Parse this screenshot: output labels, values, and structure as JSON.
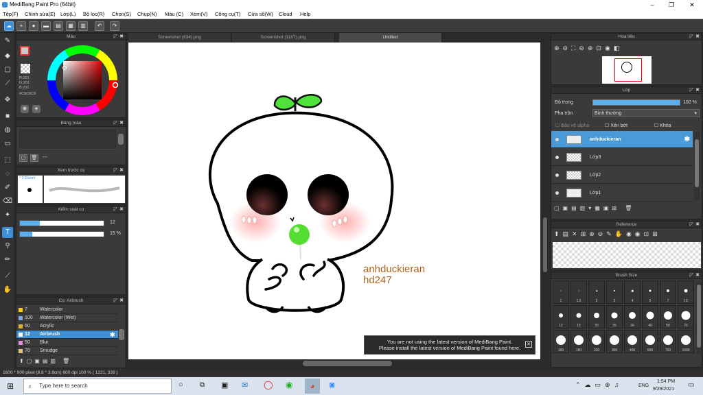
{
  "window": {
    "title": "MediBang Paint Pro (64bit)",
    "min": "–",
    "max": "❐",
    "close": "✕"
  },
  "menu": [
    "Tệp(F)",
    "Chỉnh sửa(E)",
    "Lớp(L)",
    "Bộ lọc(R)",
    "Chọn(S)",
    "Chụp(N)",
    "Màu (C)",
    "Xem(V)",
    "Công cụ(T)",
    "Cửa sổ(W)",
    "Cloud",
    "Help"
  ],
  "tabs": [
    "Screenshot (634).png",
    "Screenshot (1187).png",
    "Untitled"
  ],
  "color_panel": {
    "title": "Màu",
    "r": "R:201",
    "g": "G:201",
    "b": "B:201",
    "hex": "#C9C9C9",
    "current": "#c9c9c9"
  },
  "palette_panel": {
    "title": "Bảng màu",
    "dash": "---"
  },
  "preview_panel": {
    "title": "Xem trước cọ",
    "size": "0.51mm"
  },
  "brush_ctrl": {
    "title": "Kiểm soát cọ",
    "size_val": "12",
    "opacity_val": "15 %",
    "size_frac": 0.24,
    "opacity_frac": 0.15
  },
  "brush_list": {
    "title": "Cọ: Airbrush",
    "items": [
      {
        "size": "7",
        "name": "Watercolor",
        "color": "#ffcc00"
      },
      {
        "size": "100",
        "name": "Watercolor (Wet)",
        "color": "#7ad"
      },
      {
        "size": "50",
        "name": "Acrylic",
        "color": "#e0b030"
      },
      {
        "size": "12",
        "name": "Airbrush",
        "color": "#ffffff"
      },
      {
        "size": "50",
        "name": "Blur",
        "color": "#e890e0"
      },
      {
        "size": "70",
        "name": "Smudge",
        "color": "#e8c080"
      }
    ]
  },
  "navigator": {
    "title": "Hoa tiêu"
  },
  "layers": {
    "title": "Lớp",
    "opacity_label": "Độ trong",
    "opacity_val": "100 %",
    "blend_label": "Pha trộn",
    "blend_val": "Bình thường",
    "alpha": "Bảo vệ alpha",
    "clip": "Xén bớt",
    "lock": "Khóa",
    "items": [
      "anhduckieran",
      "Lớp3",
      "Lớp2",
      "Lớp1"
    ],
    "opacity_frac": 1.0
  },
  "reference": {
    "title": "Reference"
  },
  "brush_size": {
    "title": "Brush Size",
    "labels": [
      "1",
      "1.5",
      "2",
      "3",
      "4",
      "5",
      "7",
      "10",
      "12",
      "15",
      "20",
      "25",
      "30",
      "40",
      "50",
      "70",
      "100",
      "150",
      "200",
      "300",
      "400",
      "500",
      "700",
      "1000"
    ]
  },
  "canvas": {
    "watermark1": "anhduckieran",
    "watermark2": "hd247"
  },
  "notice": {
    "line1": "You are not using the latest version of MediBang Paint.",
    "line2": "Please install the latest version of MediBang Paint found here."
  },
  "status": "1600 * 900 pixel   (6.8 * 3.8cm)   600 dpi   100 %   ( 1221, 339 )",
  "taskbar": {
    "search": "Type here to search",
    "time": "1:54 PM",
    "date": "9/29/2021",
    "lang": "ENG"
  }
}
